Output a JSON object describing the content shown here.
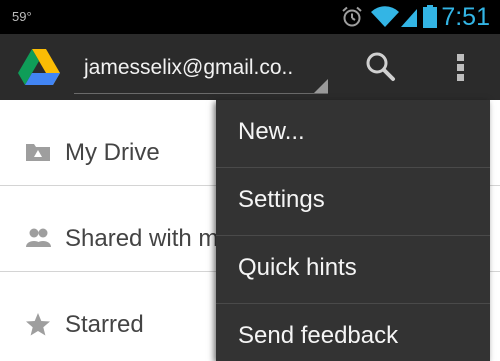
{
  "status_bar": {
    "temperature": "59°",
    "time": "7:51",
    "icons": [
      "alarm-icon",
      "wifi-icon",
      "cell-signal-icon",
      "battery-icon"
    ],
    "accent_color": "#33b5e5"
  },
  "action_bar": {
    "logo_icon": "google-drive-logo",
    "account": "jamesselix@gmail.co..",
    "search_icon": "search-icon",
    "overflow_icon": "overflow-menu-icon"
  },
  "nav": {
    "items": [
      {
        "label": "My Drive",
        "icon": "drive-folder-icon"
      },
      {
        "label": "Shared with me",
        "icon": "people-icon"
      },
      {
        "label": "Starred",
        "icon": "star-icon"
      }
    ]
  },
  "overflow_menu": {
    "items": [
      {
        "label": "New..."
      },
      {
        "label": "Settings"
      },
      {
        "label": "Quick hints"
      },
      {
        "label": "Send feedback"
      }
    ]
  }
}
